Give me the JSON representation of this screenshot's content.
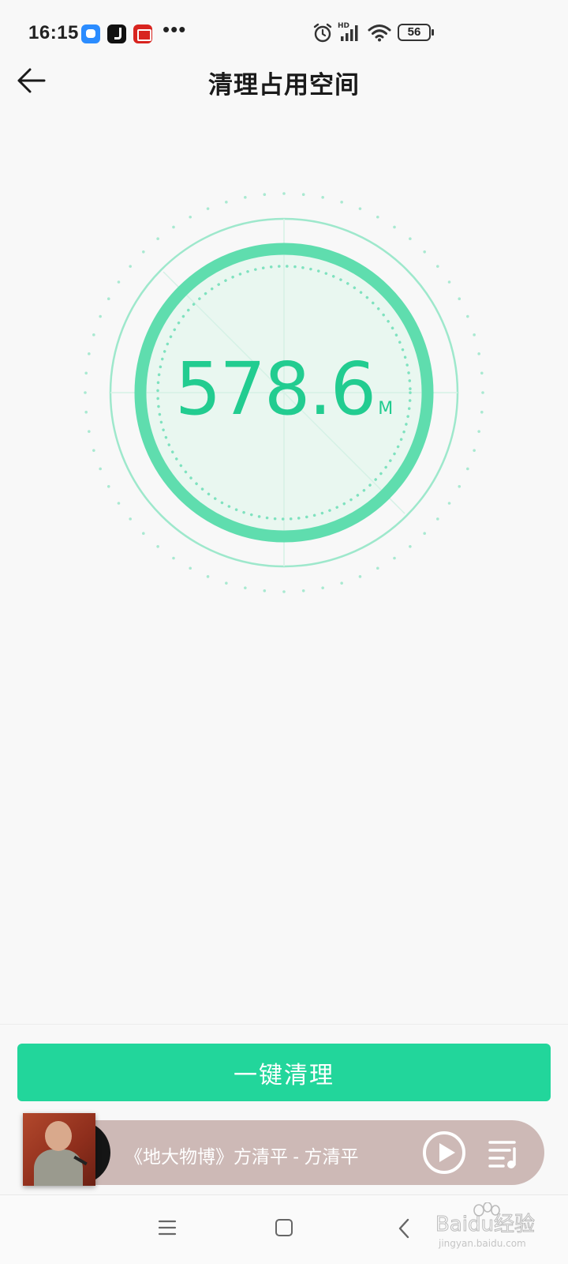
{
  "status_bar": {
    "time": "16:15",
    "notification_icons": [
      "chat-app-icon",
      "tiktok-icon",
      "toutiao-icon"
    ],
    "more": "•••",
    "indicators": [
      "alarm-icon",
      "hd-signal-icon",
      "wifi-icon"
    ],
    "network_label": "HD",
    "battery": "56"
  },
  "header": {
    "back_icon": "arrow-left-icon",
    "title": "清理占用空间"
  },
  "gauge": {
    "value": "578.6",
    "unit": "M",
    "accent_color": "#22cc90"
  },
  "actions": {
    "clean_button_label": "一键清理",
    "button_color": "#22d69b"
  },
  "music_player": {
    "song": "《地大物博》方清平 - 方清平",
    "play_icon": "play-circle-icon",
    "playlist_icon": "playlist-icon",
    "background_color": "#cdb9b6"
  },
  "nav_bar": {
    "items": [
      "menu-icon",
      "home-icon",
      "back-icon"
    ]
  },
  "watermark": {
    "brand": "Baidu经验",
    "url": "jingyan.baidu.com"
  }
}
